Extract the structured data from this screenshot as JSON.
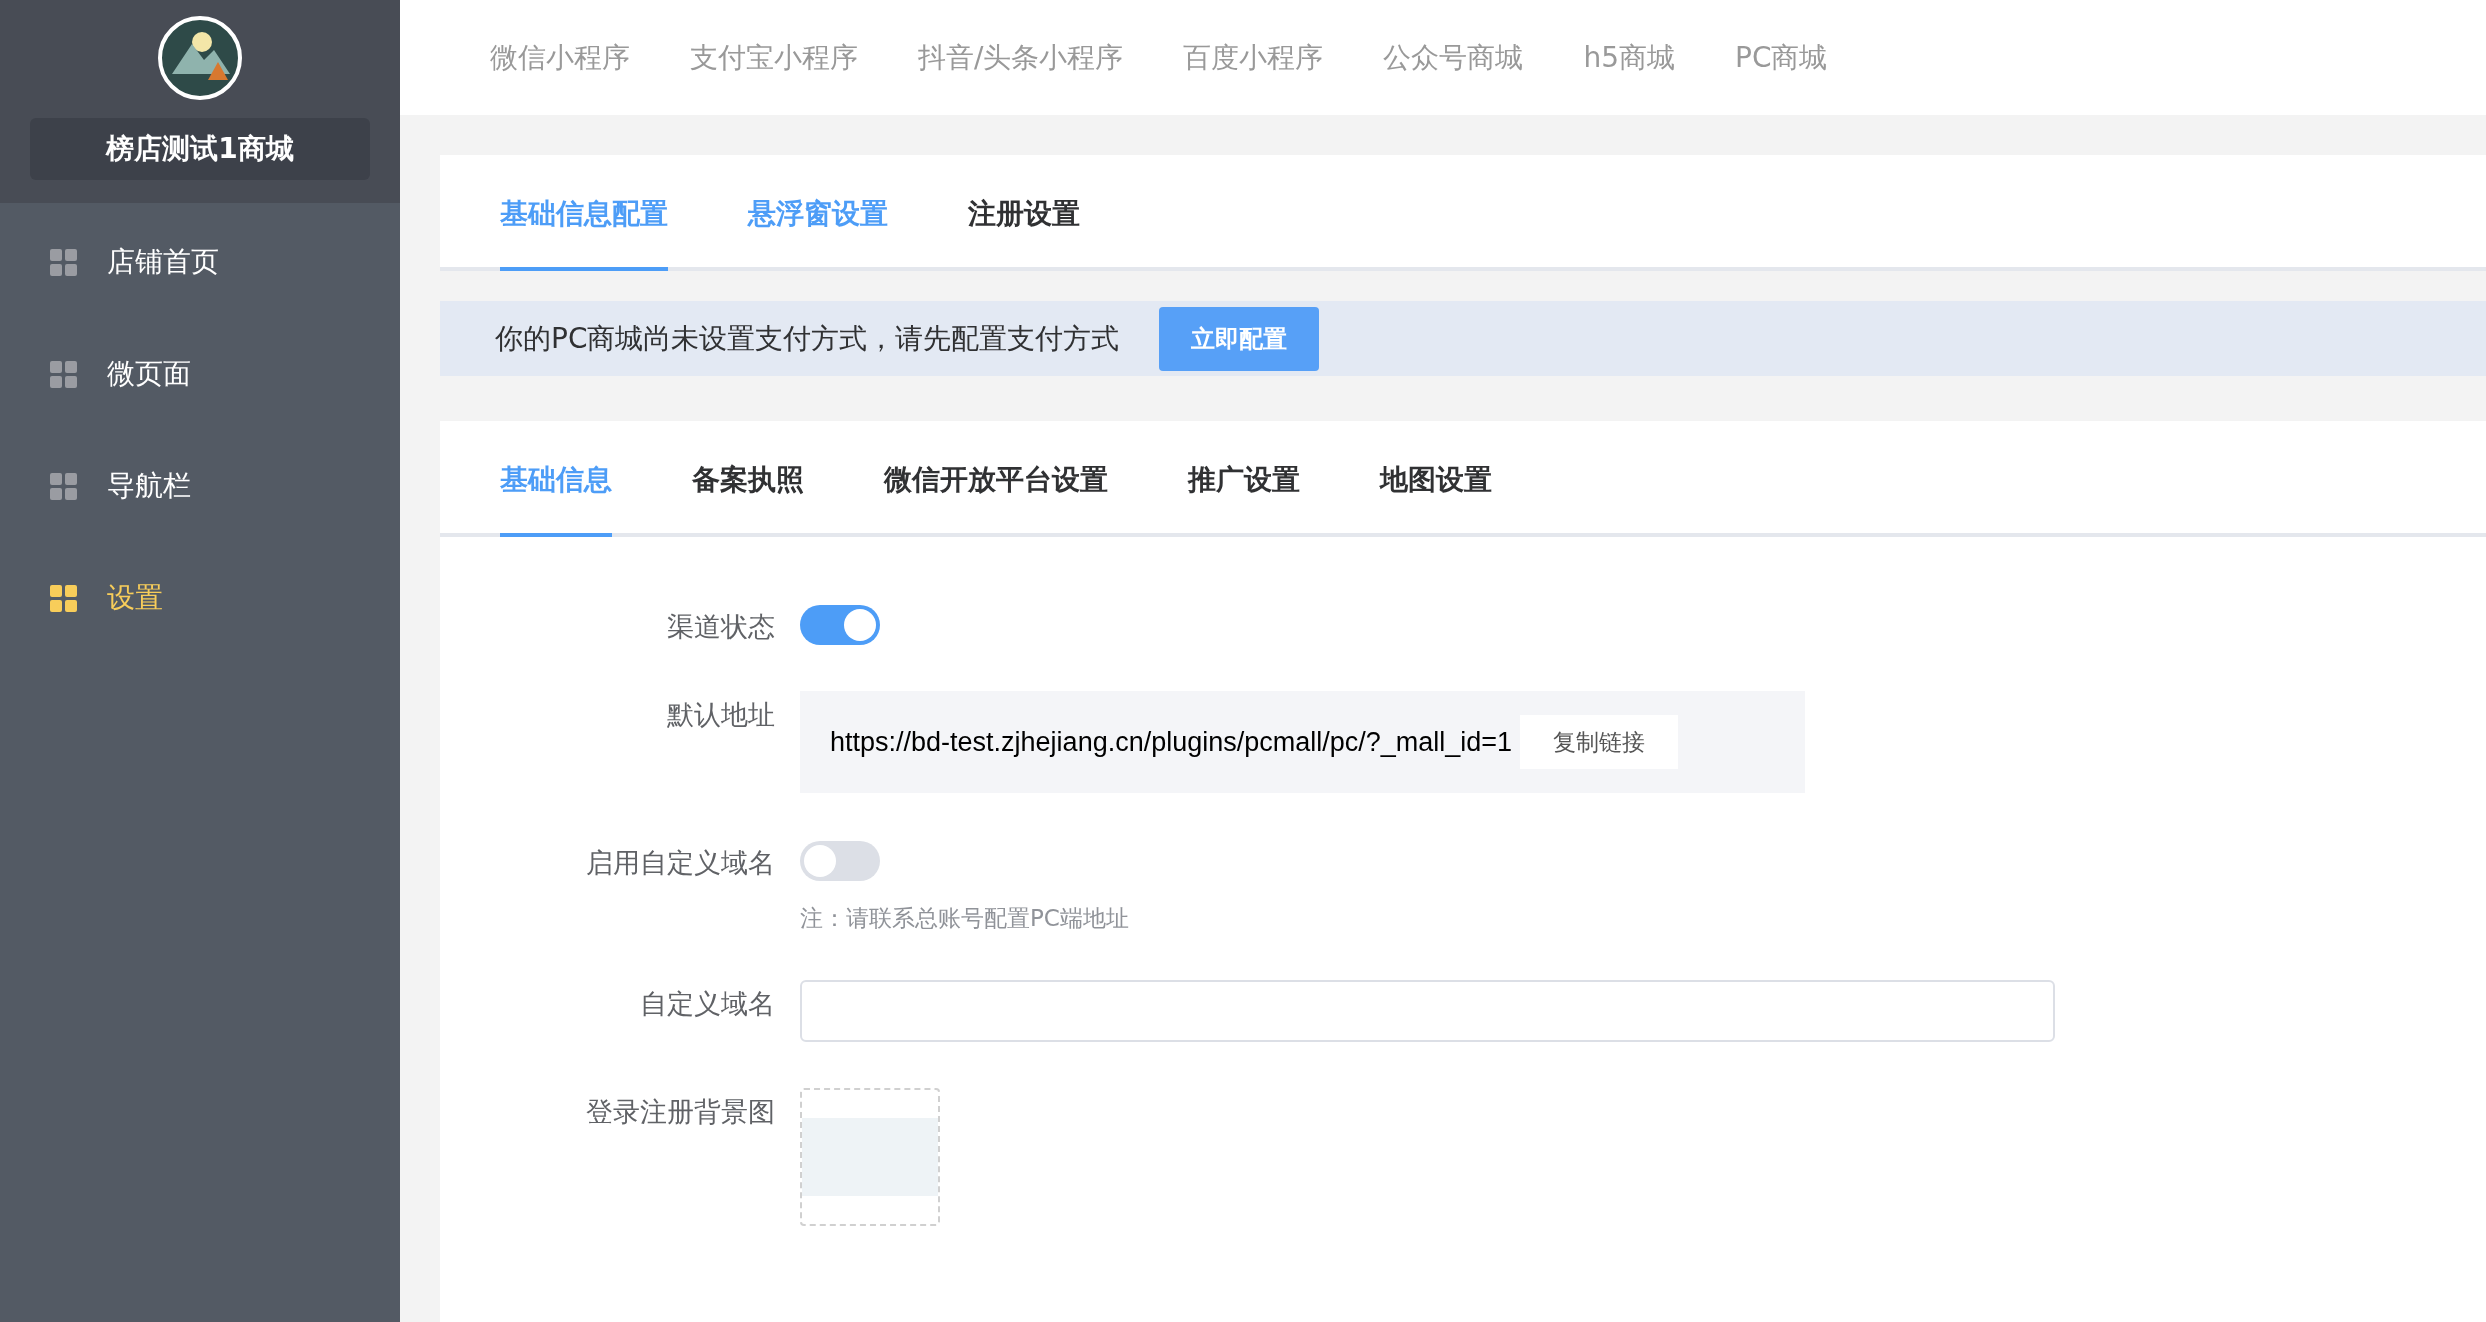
{
  "sidebar": {
    "shop_name": "榜店测试1商城",
    "items": [
      {
        "label": "店铺首页",
        "selected": false
      },
      {
        "label": "微页面",
        "selected": false
      },
      {
        "label": "导航栏",
        "selected": false
      },
      {
        "label": "设置",
        "selected": true
      }
    ]
  },
  "top_nav": [
    {
      "label": "微信小程序",
      "selected": false
    },
    {
      "label": "支付宝小程序",
      "selected": false
    },
    {
      "label": "抖音/头条小程序",
      "selected": false
    },
    {
      "label": "百度小程序",
      "selected": false
    },
    {
      "label": "公众号商城",
      "selected": false
    },
    {
      "label": "h5商城",
      "selected": false
    },
    {
      "label": "PC商城",
      "selected": false
    }
  ],
  "config_tabs": [
    {
      "label": "基础信息配置",
      "selected": true,
      "hovered": false
    },
    {
      "label": "悬浮窗设置",
      "selected": false,
      "hovered": true
    },
    {
      "label": "注册设置",
      "selected": false,
      "hovered": false
    }
  ],
  "alert": {
    "message": "你的PC商城尚未设置支付方式，请先配置支付方式",
    "button": "立即配置"
  },
  "info_tabs": [
    {
      "label": "基础信息",
      "selected": true
    },
    {
      "label": "备案执照",
      "selected": false
    },
    {
      "label": "微信开放平台设置",
      "selected": false
    },
    {
      "label": "推广设置",
      "selected": false
    },
    {
      "label": "地图设置",
      "selected": false
    }
  ],
  "form": [
    {
      "kind": "switch",
      "label": "渠道状态",
      "on": true
    },
    {
      "kind": "link",
      "label": "默认地址",
      "value": "https://bd-test.zjhejiang.cn/plugins/pcmall/pc/?_mall_id=1",
      "button": "复制链接"
    },
    {
      "kind": "switch",
      "label": "启用自定义域名",
      "on": false,
      "note": "注：请联系总账号配置PC端地址"
    },
    {
      "kind": "input",
      "label": "自定义域名"
    },
    {
      "kind": "image",
      "label": "登录注册背景图"
    }
  ]
}
